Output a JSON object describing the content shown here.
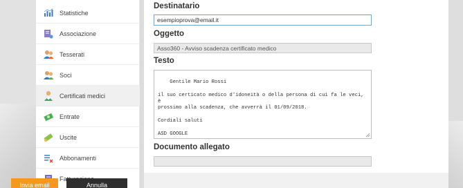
{
  "sidebar": {
    "items": [
      {
        "label": "Statistiche",
        "icon": "bar-chart-icon",
        "active": false
      },
      {
        "label": "Associazione",
        "icon": "association-icon",
        "active": false
      },
      {
        "label": "Tesserati",
        "icon": "members-icon",
        "active": false
      },
      {
        "label": "Soci",
        "icon": "partners-icon",
        "active": false
      },
      {
        "label": "Certificati medici",
        "icon": "doctor-icon",
        "active": true
      },
      {
        "label": "Entrate",
        "icon": "income-icon",
        "active": false
      },
      {
        "label": "Uscite",
        "icon": "expenses-icon",
        "active": false
      },
      {
        "label": "Abbonamenti",
        "icon": "subscriptions-icon",
        "active": false
      },
      {
        "label": "Fatturazione",
        "icon": "invoice-icon",
        "active": false
      }
    ]
  },
  "form": {
    "recipient_label": "Destinatario",
    "recipient_value": "esempioprova@email.it",
    "subject_label": "Oggetto",
    "subject_value": "Asso360 - Avviso scadenza certificato medico",
    "body_label": "Testo",
    "body_value": "Gentile Mario Rossi\n\nil suo certicato medico d'idoneità o della persona di cui fa le veci, è\nprossimo alla scadenza, che avverrà il 01/09/2018.\n\nCordiali saluti\n\nASD GOOGLE",
    "attachment_label": "Documento allegato",
    "attachment_value": ""
  },
  "actions": {
    "send_label": "Invia email",
    "cancel_label": "Annulla"
  },
  "colors": {
    "accent": "#f39a1e",
    "dark_button": "#2f2f2f",
    "active_field_border": "#7aa3cc"
  }
}
